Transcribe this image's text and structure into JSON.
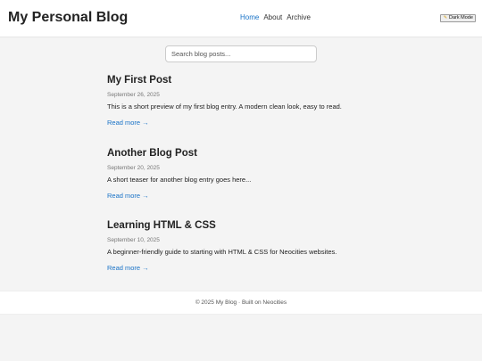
{
  "header": {
    "site_title": "My Personal Blog",
    "nav": [
      {
        "label": "Home",
        "active": true
      },
      {
        "label": "About",
        "active": false
      },
      {
        "label": "Archive",
        "active": false
      }
    ],
    "mode_toggle": {
      "label": "Dark Mode",
      "icon": "pencil-icon"
    }
  },
  "search": {
    "placeholder": "Search blog posts...",
    "value": ""
  },
  "posts": [
    {
      "title": "My First Post",
      "date": "September 26, 2025",
      "excerpt": "This is a short preview of my first blog entry. A modern clean look, easy to read.",
      "read_more": "Read more →"
    },
    {
      "title": "Another Blog Post",
      "date": "September 20, 2025",
      "excerpt": "A short teaser for another blog entry goes here...",
      "read_more": "Read more →"
    },
    {
      "title": "Learning HTML & CSS",
      "date": "September 10, 2025",
      "excerpt": "A beginner-friendly guide to starting with HTML & CSS for Neocities websites.",
      "read_more": "Read more →"
    }
  ],
  "footer": {
    "text": "© 2025 My Blog · Built on Neocities"
  },
  "colors": {
    "accent": "#1a73c7",
    "page_background": "#f4f4f4",
    "text": "#222222",
    "muted": "#777777"
  }
}
